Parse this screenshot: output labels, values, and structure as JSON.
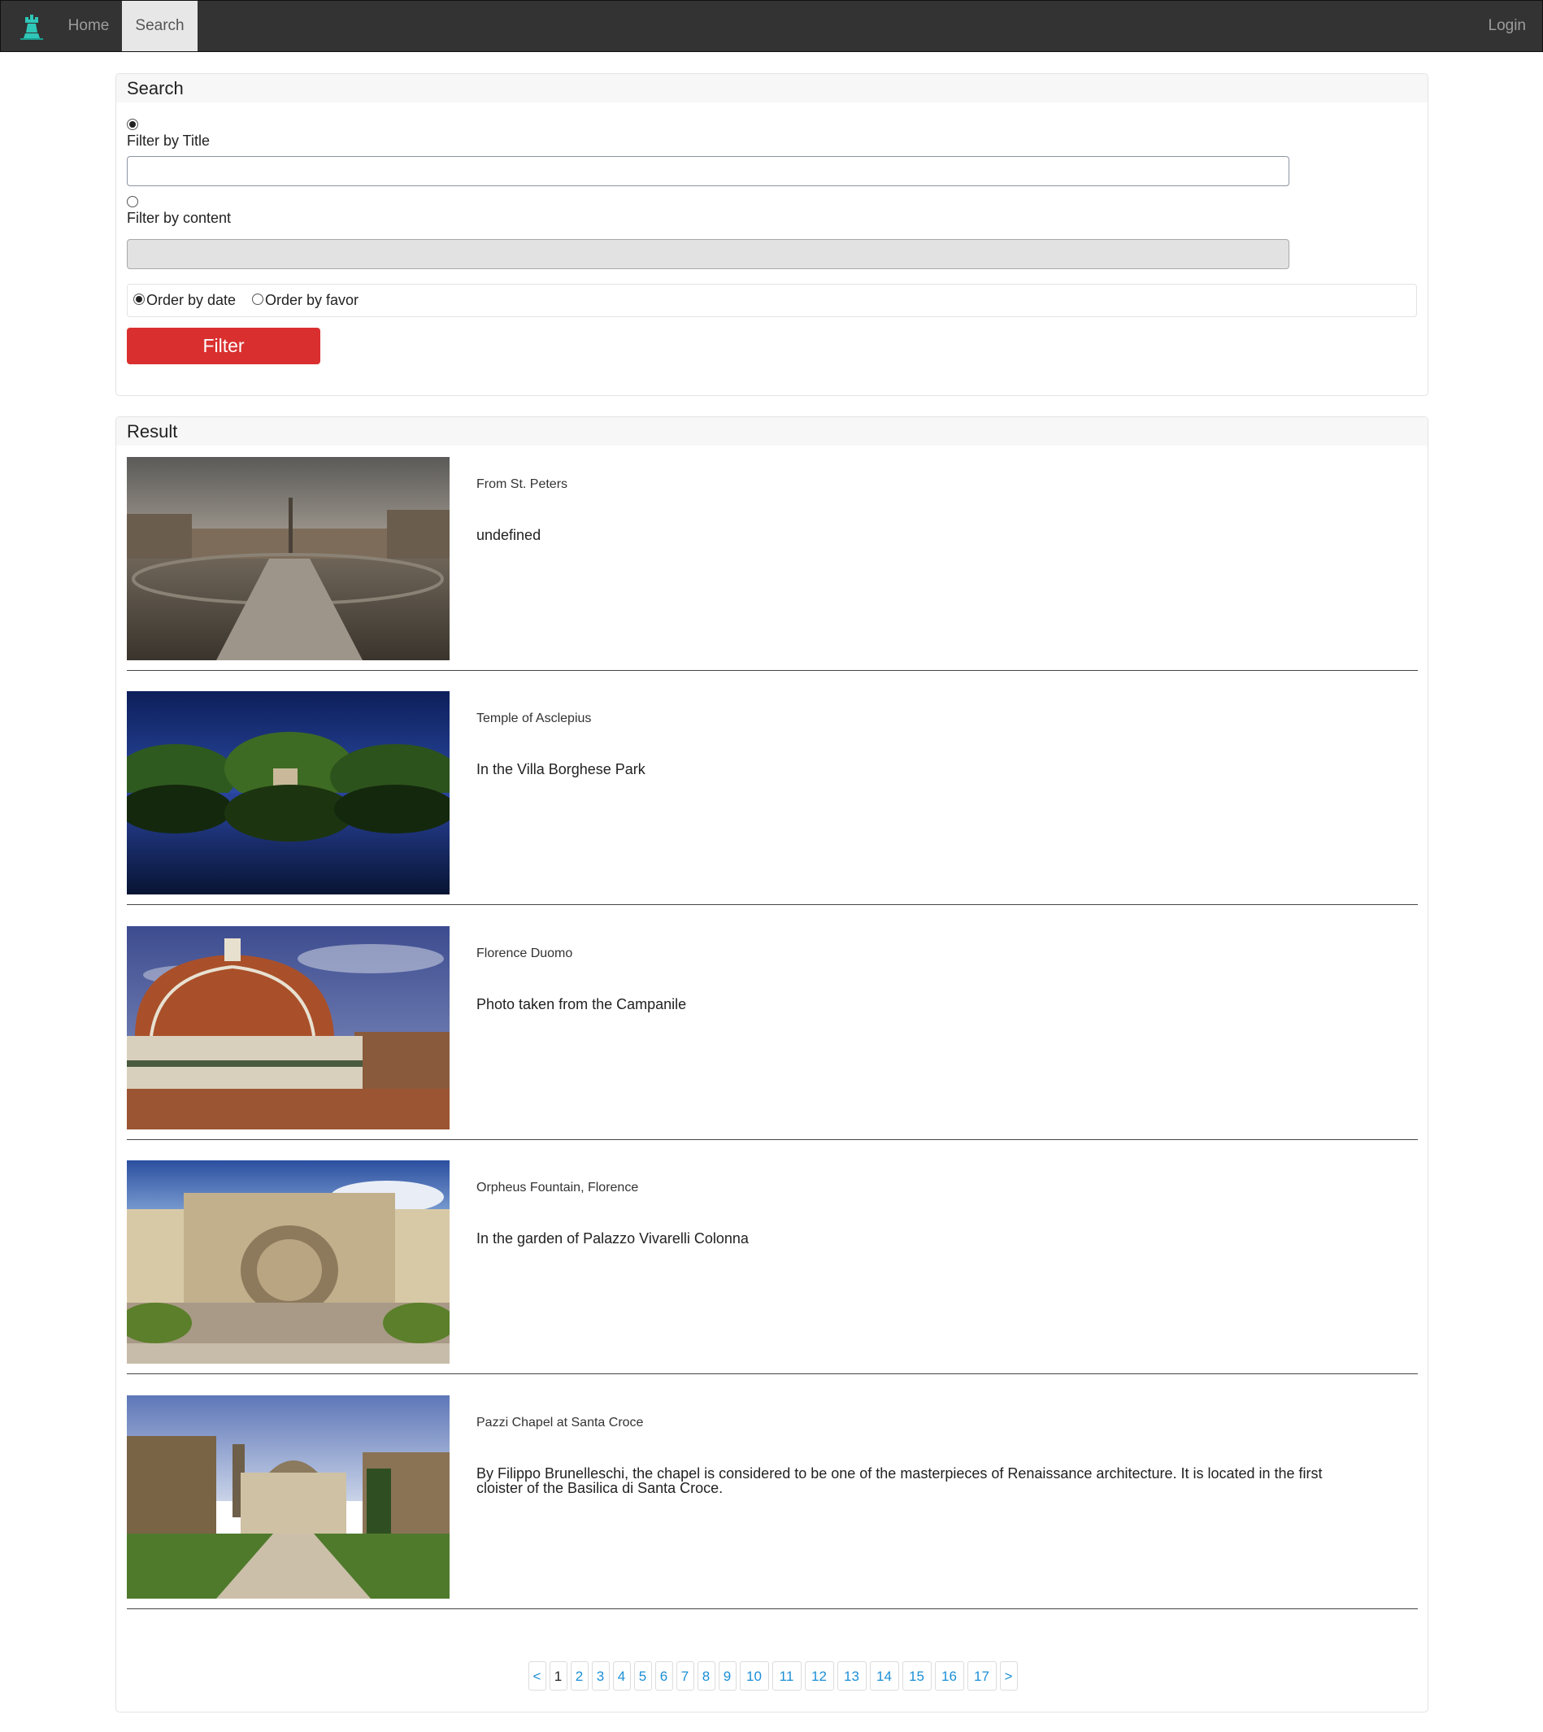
{
  "nav": {
    "home": "Home",
    "search": "Search",
    "login": "Login",
    "brand_icon": "rook-logo-icon",
    "brand_color": "#2fc7b8"
  },
  "search_panel": {
    "heading": "Search",
    "filter_title_label": "Filter by Title",
    "filter_title_value": "",
    "filter_title_selected": true,
    "filter_content_label": "Filter by content",
    "filter_content_value": "",
    "filter_content_selected": false,
    "order_by_date_label": "Order by date",
    "order_by_date_selected": true,
    "order_by_favor_label": "Order by favor",
    "order_by_favor_selected": false,
    "filter_button": "Filter",
    "filter_button_color": "#d9302f"
  },
  "result_panel": {
    "heading": "Result",
    "items": [
      {
        "title": "From St. Peters",
        "description": "undefined"
      },
      {
        "title": "Temple of Asclepius",
        "description": "In the Villa Borghese Park"
      },
      {
        "title": "Florence Duomo",
        "description": "Photo taken from the Campanile"
      },
      {
        "title": "Orpheus Fountain, Florence",
        "description": "In the garden of Palazzo Vivarelli Colonna"
      },
      {
        "title": "Pazzi Chapel at Santa Croce",
        "description": "By Filippo Brunelleschi, the chapel is considered to be one of the masterpieces of Renaissance architecture. It is located in the first cloister of the Basilica di Santa Croce."
      }
    ]
  },
  "pagination": {
    "prev": "<",
    "next": ">",
    "current": "1",
    "pages": [
      "1",
      "2",
      "3",
      "4",
      "5",
      "6",
      "7",
      "8",
      "9",
      "10",
      "11",
      "12",
      "13",
      "14",
      "15",
      "16",
      "17"
    ]
  }
}
